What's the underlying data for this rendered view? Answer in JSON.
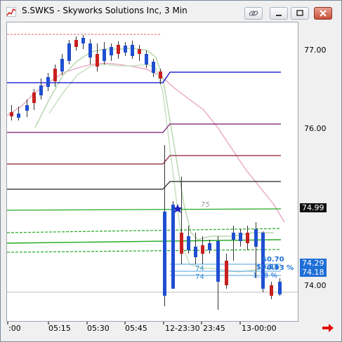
{
  "window": {
    "title": "S.SWKS - Skyworks Solutions Inc, 3 Min",
    "buttons": [
      "link-icon",
      "minimize-icon",
      "restore-icon",
      "close-icon"
    ]
  },
  "price_axis": {
    "labels": [
      "77.00",
      "76.00",
      "74.00"
    ],
    "tags": [
      {
        "text": "74.99",
        "color": "#000000"
      },
      {
        "text": "74.29",
        "color": "#1e6fd6"
      },
      {
        "text": "74.18",
        "color": "#1e6fd6"
      }
    ]
  },
  "time_axis": {
    "labels": [
      ":00",
      "05:15",
      "05:30",
      "05:45",
      "12-23:30",
      "23:45",
      "13-00:00"
    ]
  },
  "chart_labels": {
    "ma_label": "75",
    "level_label_1": "74",
    "level_label_2": "74",
    "change_1": "$0.70",
    "change_2": "$0.83",
    "pct_1": "0.93 %",
    "pct_2": "1.18 %"
  },
  "colors": {
    "up_candle": "#1f4fd1",
    "down_candle": "#c8201e",
    "accent_blue": "#1e6fd6",
    "alert_arrow": "#e0100a"
  }
}
